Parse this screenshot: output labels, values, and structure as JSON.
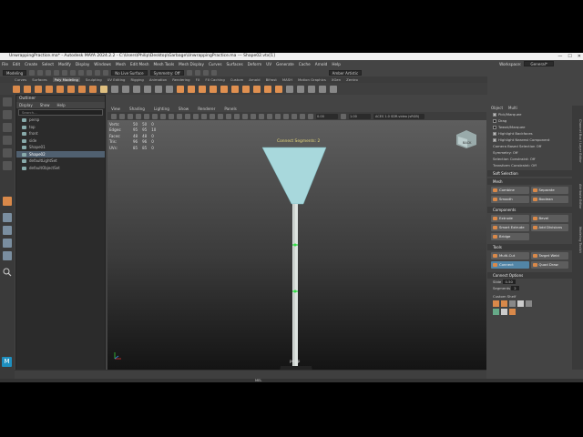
{
  "window": {
    "title": "UnwrappingPractice.ma* - Autodesk MAYA 2024.2.2 - C:\\Users\\Philip\\Desktop\\Garbage\\UnwrappingPractice.ma --- Shape02.vtx[1]",
    "controls": [
      "—",
      "☐",
      "✕"
    ]
  },
  "menubar": {
    "items": [
      "File",
      "Edit",
      "Create",
      "Select",
      "Modify",
      "Display",
      "Windows",
      "Mesh",
      "Edit Mesh",
      "Mesh Tools",
      "Mesh Display",
      "Curves",
      "Surfaces",
      "Deform",
      "UV",
      "Generate",
      "Cache",
      "Arnold",
      "Help"
    ],
    "workspace_label": "Workspace:",
    "workspace_value": "General*"
  },
  "statusline": {
    "mode": "Modeling",
    "symmetry": "No Live Surface",
    "symmetry2": "Symmetry: Off",
    "user": "Amber Artistic"
  },
  "shelf": {
    "tabs": [
      "Curves",
      "Surfaces",
      "Poly Modeling",
      "Sculpting",
      "UV Editing",
      "Rigging",
      "Animation",
      "Rendering",
      "FX",
      "FX Caching",
      "Custom",
      "Arnold",
      "Bifrost",
      "MASH",
      "Motion Graphics",
      "XGen",
      "Zentro"
    ],
    "active_tab": "Poly Modeling"
  },
  "outliner": {
    "title": "Outliner",
    "menus": [
      "Display",
      "Show",
      "Help"
    ],
    "search_placeholder": "Search...",
    "items": [
      {
        "label": "persp",
        "selected": false
      },
      {
        "label": "top",
        "selected": false
      },
      {
        "label": "front",
        "selected": false
      },
      {
        "label": "side",
        "selected": false
      },
      {
        "label": "Shape01",
        "selected": false
      },
      {
        "label": "Shape02",
        "selected": true
      },
      {
        "label": "defaultLightSet",
        "selected": false
      },
      {
        "label": "defaultObjectSet",
        "selected": false
      }
    ]
  },
  "viewport": {
    "menus": [
      "View",
      "Shading",
      "Lighting",
      "Show",
      "Renderer",
      "Panels"
    ],
    "field1": "0.00",
    "field2": "1.00",
    "colorspace": "ACES 1.0 SDR-video (sRGB)",
    "hud": [
      {
        "label": "Verts:",
        "a": "50",
        "b": "50",
        "c": "0"
      },
      {
        "label": "Edges:",
        "a": "95",
        "b": "95",
        "c": "10"
      },
      {
        "label": "Faces:",
        "a": "48",
        "b": "48",
        "c": "0"
      },
      {
        "label": "Tris:",
        "a": "96",
        "b": "96",
        "c": "0"
      },
      {
        "label": "UVs:",
        "a": "85",
        "b": "85",
        "c": "0"
      }
    ],
    "tool_label": "Connect Segments: 2",
    "camera_label": "persp",
    "cube_label": "BACK"
  },
  "modeling_toolkit": {
    "header": [
      "Object",
      "Multi"
    ],
    "options": [
      {
        "label": "Pick/Marquee",
        "checked": true
      },
      {
        "label": "Drag",
        "checked": false
      },
      {
        "label": "Tweak/Marquee",
        "checked": false
      },
      {
        "label": "Highlight Backfaces",
        "checked": true
      },
      {
        "label": "Highlight Nearest Component",
        "checked": true
      }
    ],
    "camera_based_selection": "Camera Based Selection",
    "camera_based_value": "Off",
    "symmetry": "Symmetry:",
    "symmetry_value": "Off",
    "selection_constraint": "Selection Constraint:",
    "selection_constraint_value": "Off",
    "transform_constraint": "Transform Constraint:",
    "transform_constraint_value": "Off",
    "soft_selection": "Soft Selection",
    "sections": {
      "mesh": "Mesh",
      "components": "Components",
      "tools": "Tools",
      "connect_options": "Connect Options",
      "custom_shelf": "Custom Shelf"
    },
    "mesh_buttons": [
      "Combine",
      "Separate",
      "Smooth",
      "Boolean"
    ],
    "component_buttons": [
      "Extrude",
      "Bevel",
      "Smart Extrude",
      "Add Divisions",
      "Bridge"
    ],
    "tool_buttons": [
      {
        "label": "Multi-Cut",
        "active": false
      },
      {
        "label": "Target Weld",
        "active": false
      },
      {
        "label": "Connect",
        "active": true
      },
      {
        "label": "Quad Draw",
        "active": false
      }
    ],
    "connect_slide_label": "Slide",
    "connect_slide_value": "0.50",
    "connect_segments_label": "Segments",
    "connect_segments_value": "2"
  },
  "sidetabs": [
    "Channel Box / Layer Editor",
    "Attribute Editor",
    "Modeling Toolkit"
  ],
  "commandline": {
    "label": "MEL"
  },
  "logo": "M",
  "colors": {
    "accent": "#5285a6",
    "object": "#a8d8dc",
    "selected_vertex": "#33dd44"
  }
}
